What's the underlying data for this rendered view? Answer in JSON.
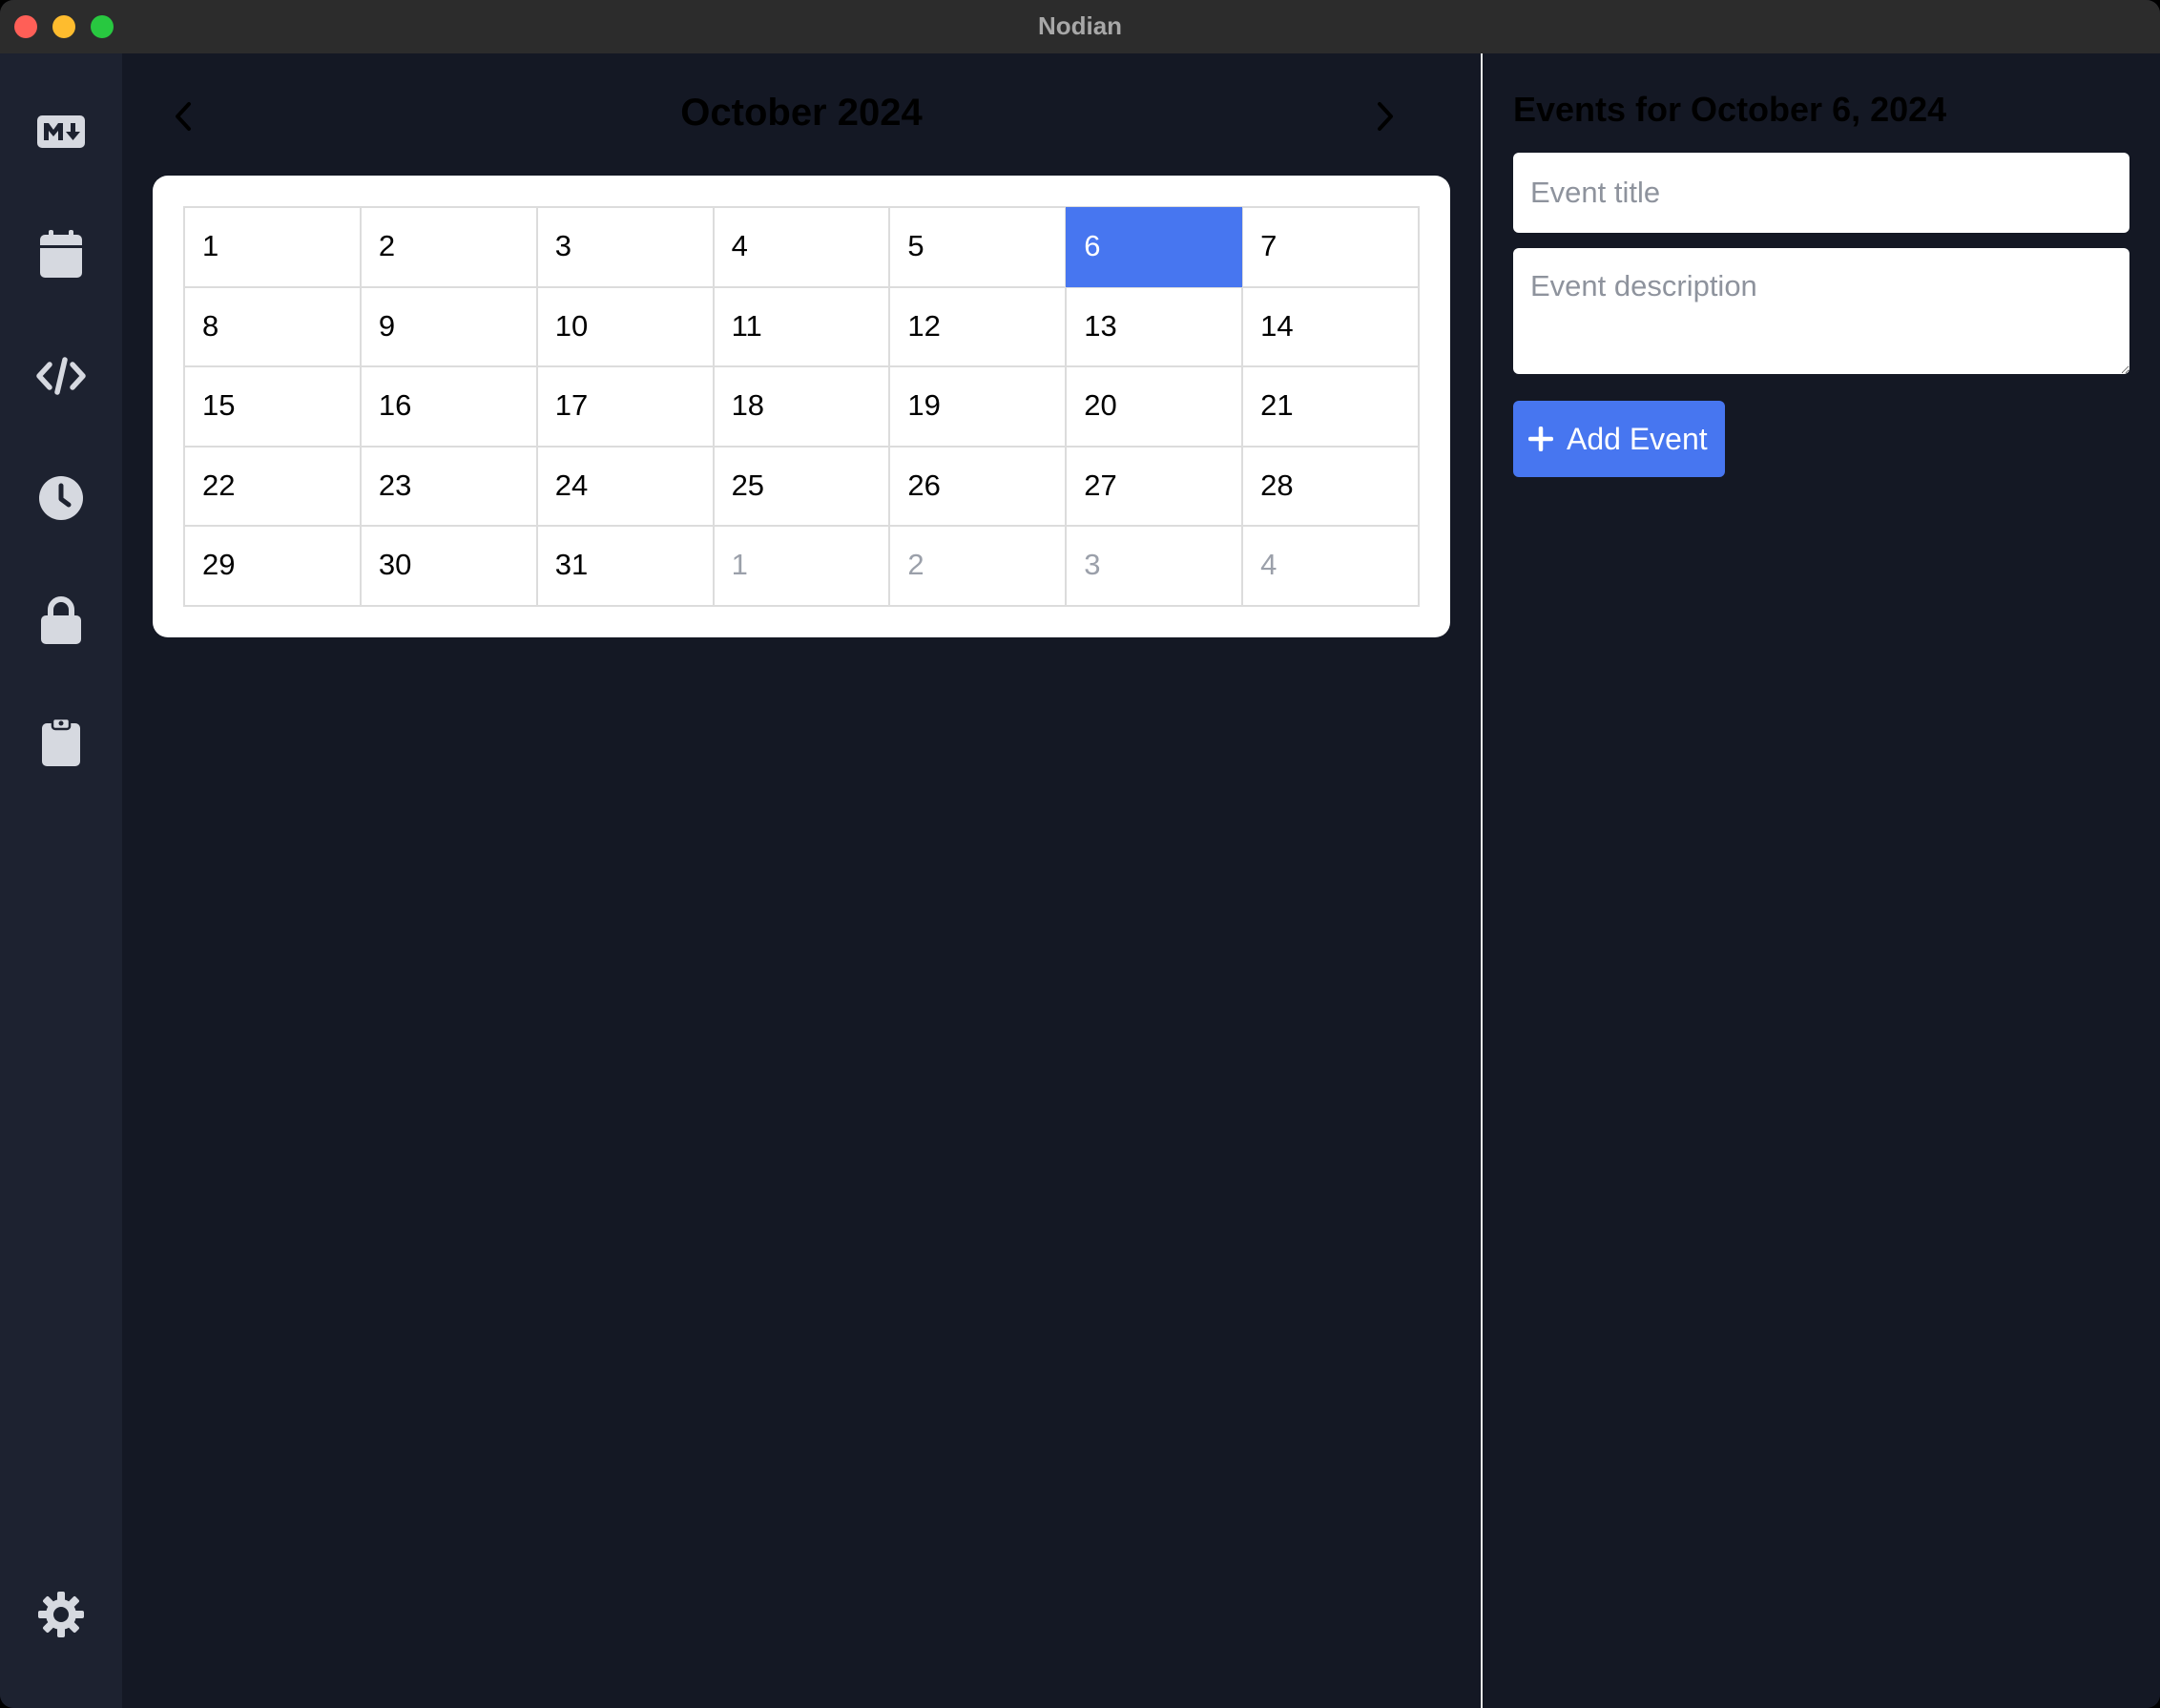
{
  "window": {
    "title": "Nodian"
  },
  "sidebar": {
    "items": [
      {
        "name": "markdown-icon"
      },
      {
        "name": "calendar-icon"
      },
      {
        "name": "code-icon"
      },
      {
        "name": "clock-icon"
      },
      {
        "name": "lock-icon"
      },
      {
        "name": "clipboard-icon"
      }
    ],
    "settings": {
      "name": "gear-icon"
    }
  },
  "calendar": {
    "month_label": "October 2024",
    "prev_icon": "chevron-left-icon",
    "next_icon": "chevron-right-icon",
    "days": [
      {
        "label": "1",
        "muted": false,
        "selected": false
      },
      {
        "label": "2",
        "muted": false,
        "selected": false
      },
      {
        "label": "3",
        "muted": false,
        "selected": false
      },
      {
        "label": "4",
        "muted": false,
        "selected": false
      },
      {
        "label": "5",
        "muted": false,
        "selected": false
      },
      {
        "label": "6",
        "muted": false,
        "selected": true
      },
      {
        "label": "7",
        "muted": false,
        "selected": false
      },
      {
        "label": "8",
        "muted": false,
        "selected": false
      },
      {
        "label": "9",
        "muted": false,
        "selected": false
      },
      {
        "label": "10",
        "muted": false,
        "selected": false
      },
      {
        "label": "11",
        "muted": false,
        "selected": false
      },
      {
        "label": "12",
        "muted": false,
        "selected": false
      },
      {
        "label": "13",
        "muted": false,
        "selected": false
      },
      {
        "label": "14",
        "muted": false,
        "selected": false
      },
      {
        "label": "15",
        "muted": false,
        "selected": false
      },
      {
        "label": "16",
        "muted": false,
        "selected": false
      },
      {
        "label": "17",
        "muted": false,
        "selected": false
      },
      {
        "label": "18",
        "muted": false,
        "selected": false
      },
      {
        "label": "19",
        "muted": false,
        "selected": false
      },
      {
        "label": "20",
        "muted": false,
        "selected": false
      },
      {
        "label": "21",
        "muted": false,
        "selected": false
      },
      {
        "label": "22",
        "muted": false,
        "selected": false
      },
      {
        "label": "23",
        "muted": false,
        "selected": false
      },
      {
        "label": "24",
        "muted": false,
        "selected": false
      },
      {
        "label": "25",
        "muted": false,
        "selected": false
      },
      {
        "label": "26",
        "muted": false,
        "selected": false
      },
      {
        "label": "27",
        "muted": false,
        "selected": false
      },
      {
        "label": "28",
        "muted": false,
        "selected": false
      },
      {
        "label": "29",
        "muted": false,
        "selected": false
      },
      {
        "label": "30",
        "muted": false,
        "selected": false
      },
      {
        "label": "31",
        "muted": false,
        "selected": false
      },
      {
        "label": "1",
        "muted": true,
        "selected": false
      },
      {
        "label": "2",
        "muted": true,
        "selected": false
      },
      {
        "label": "3",
        "muted": true,
        "selected": false
      },
      {
        "label": "4",
        "muted": true,
        "selected": false
      }
    ]
  },
  "events_panel": {
    "heading": "Events for October 6, 2024",
    "title_input": {
      "value": "",
      "placeholder": "Event title"
    },
    "description_input": {
      "value": "",
      "placeholder": "Event description"
    },
    "add_button_label": "Add Event",
    "add_button_icon": "plus-icon"
  },
  "colors": {
    "accent": "#4776f0",
    "main_bg": "#141824",
    "sidebar_bg": "#1d2230",
    "sidebar_icon": "#d6d9e0"
  }
}
